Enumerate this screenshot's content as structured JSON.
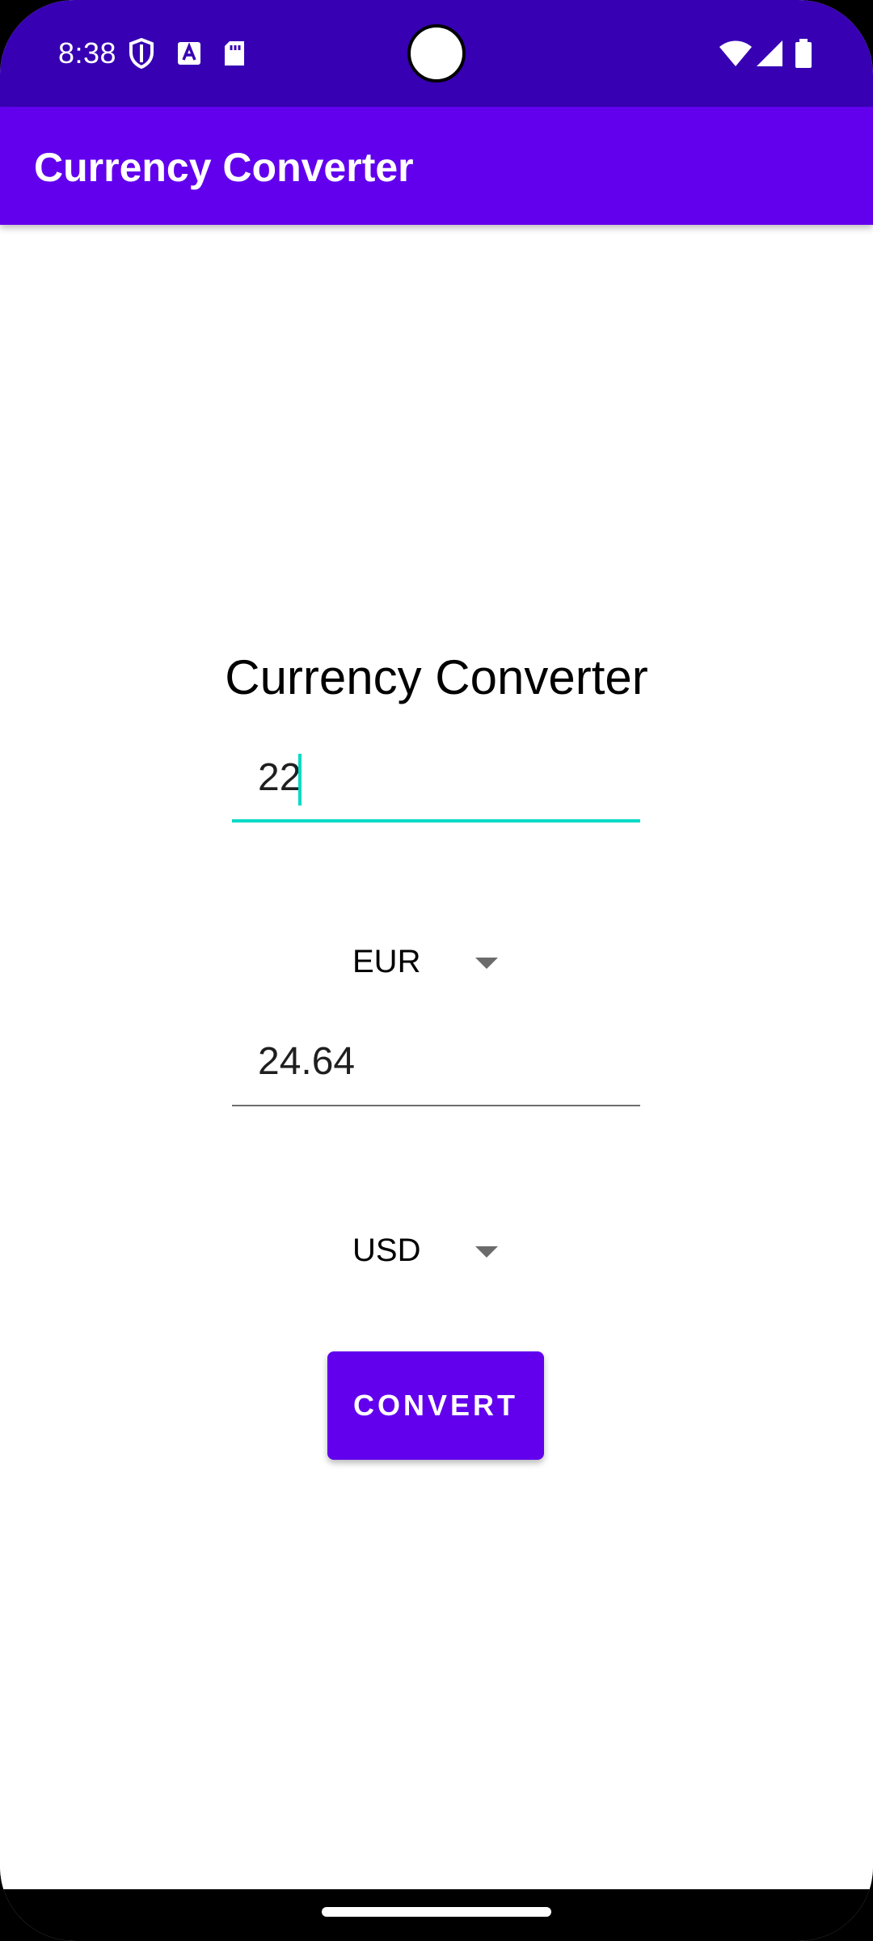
{
  "status_bar": {
    "time": "8:38",
    "left_icons": [
      "shield-icon",
      "keyboard-a-icon",
      "sd-card-icon"
    ],
    "right_icons": [
      "wifi-icon",
      "signal-icon",
      "battery-icon"
    ],
    "colors": {
      "background": "#3700b3"
    }
  },
  "app_bar": {
    "title": "Currency Converter",
    "colors": {
      "background": "#6200ee"
    }
  },
  "main": {
    "heading": "Currency Converter",
    "amount_input": {
      "value": "22"
    },
    "from_currency": {
      "selected": "EUR"
    },
    "result_field": {
      "value": "24.64"
    },
    "to_currency": {
      "selected": "USD"
    },
    "convert_button": {
      "label": "CONVERT"
    },
    "colors": {
      "accent": "#03dac5",
      "primary": "#6200ee"
    }
  }
}
